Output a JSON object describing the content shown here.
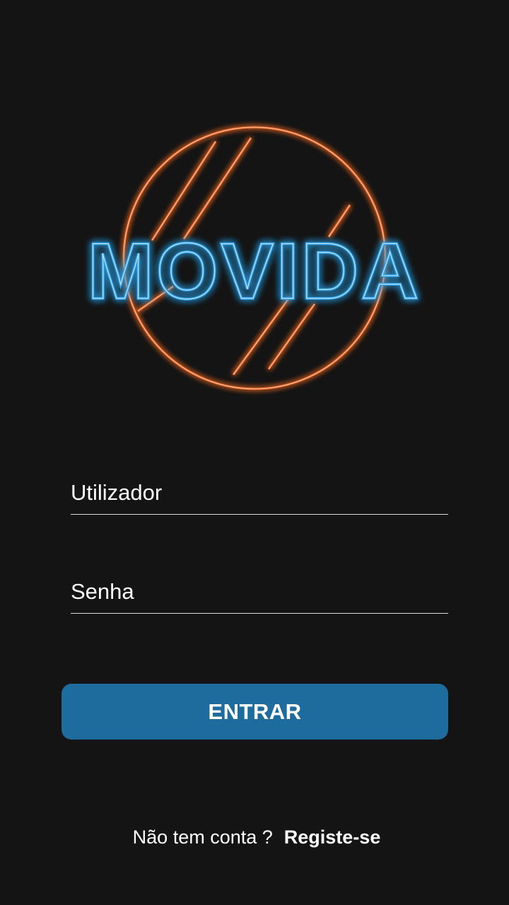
{
  "app": {
    "logo_text": "MOVIDA",
    "colors": {
      "background": "#141414",
      "neon_orange": "#f06a2a",
      "neon_blue": "#2a9be0",
      "button": "#1e6b9e",
      "text": "#ffffff"
    }
  },
  "login": {
    "username": {
      "placeholder": "Utilizador",
      "value": ""
    },
    "password": {
      "placeholder": "Senha",
      "value": ""
    },
    "submit_label": "ENTRAR",
    "signup_prompt": "Não tem conta ?",
    "signup_link": "Registe-se"
  }
}
